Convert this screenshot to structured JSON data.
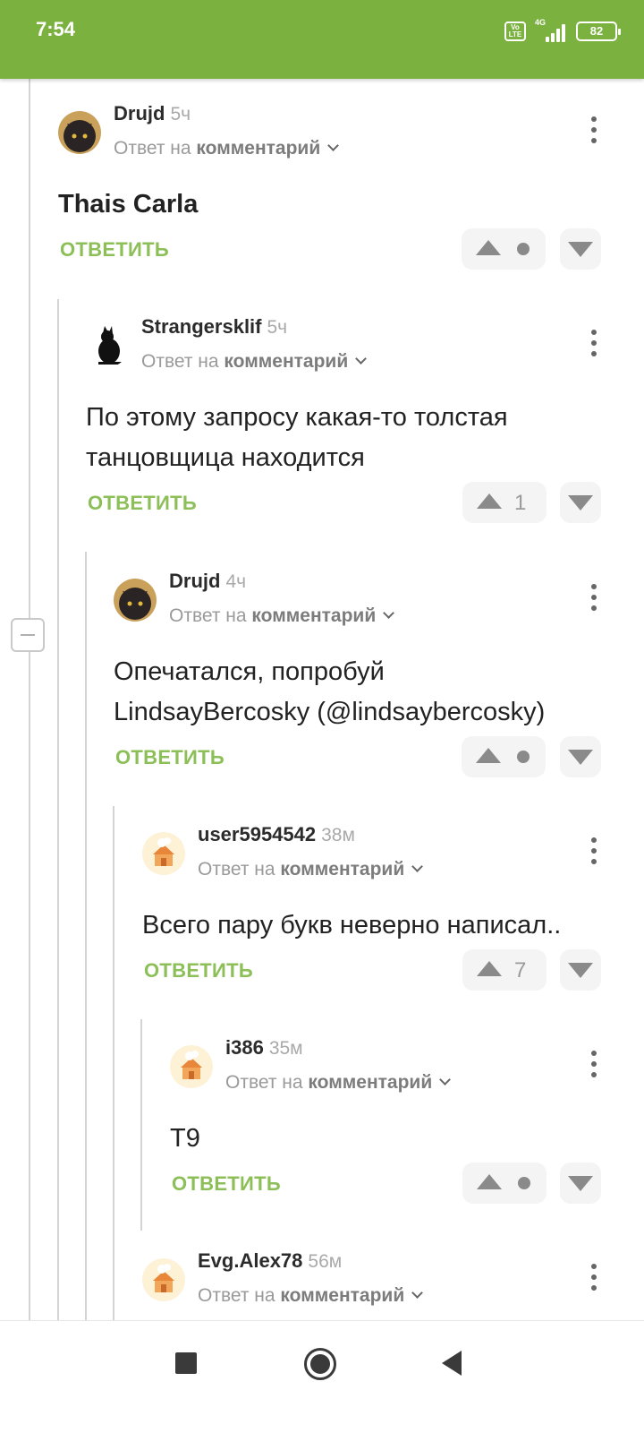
{
  "status_bar": {
    "time": "7:54",
    "network": "4G",
    "volte": "Vo LTE",
    "battery": "82"
  },
  "labels": {
    "reply_prefix": "Ответ на ",
    "reply_target": "комментарий",
    "answer_button": "ОТВЕТИТЬ"
  },
  "comments": [
    {
      "author": "Drujd",
      "time": "5ч",
      "text": [
        "Thais Carla"
      ],
      "rating": null
    },
    {
      "author": "Strangersklif",
      "time": "5ч",
      "text": [
        "По этому запросу какая-то толстая",
        "танцовщица находится"
      ],
      "rating": "1"
    },
    {
      "author": "Drujd",
      "time": "4ч",
      "text": [
        "Опечатался, попробуй",
        "LindsayBercosky (@lindsaybercosky)"
      ],
      "rating": null
    },
    {
      "author": "user5954542",
      "time": "38м",
      "text": [
        "Всего пару букв неверно написал.."
      ],
      "rating": "7"
    },
    {
      "author": "i386",
      "time": "35м",
      "text": [
        "Т9"
      ],
      "rating": null
    },
    {
      "author": "Evg.Alex78",
      "time": "56м",
      "text": [],
      "rating": null
    }
  ],
  "icons": {
    "collapse": "minus-icon",
    "more": "more-vertical-icon",
    "upvote": "arrow-up-icon",
    "downvote": "arrow-down-icon",
    "chevron": "chevron-down-icon",
    "nav": [
      "square-icon",
      "home-circle-icon",
      "back-triangle-icon"
    ]
  },
  "colors": {
    "brand": "#7ab13f",
    "answer": "#8cbf57"
  }
}
